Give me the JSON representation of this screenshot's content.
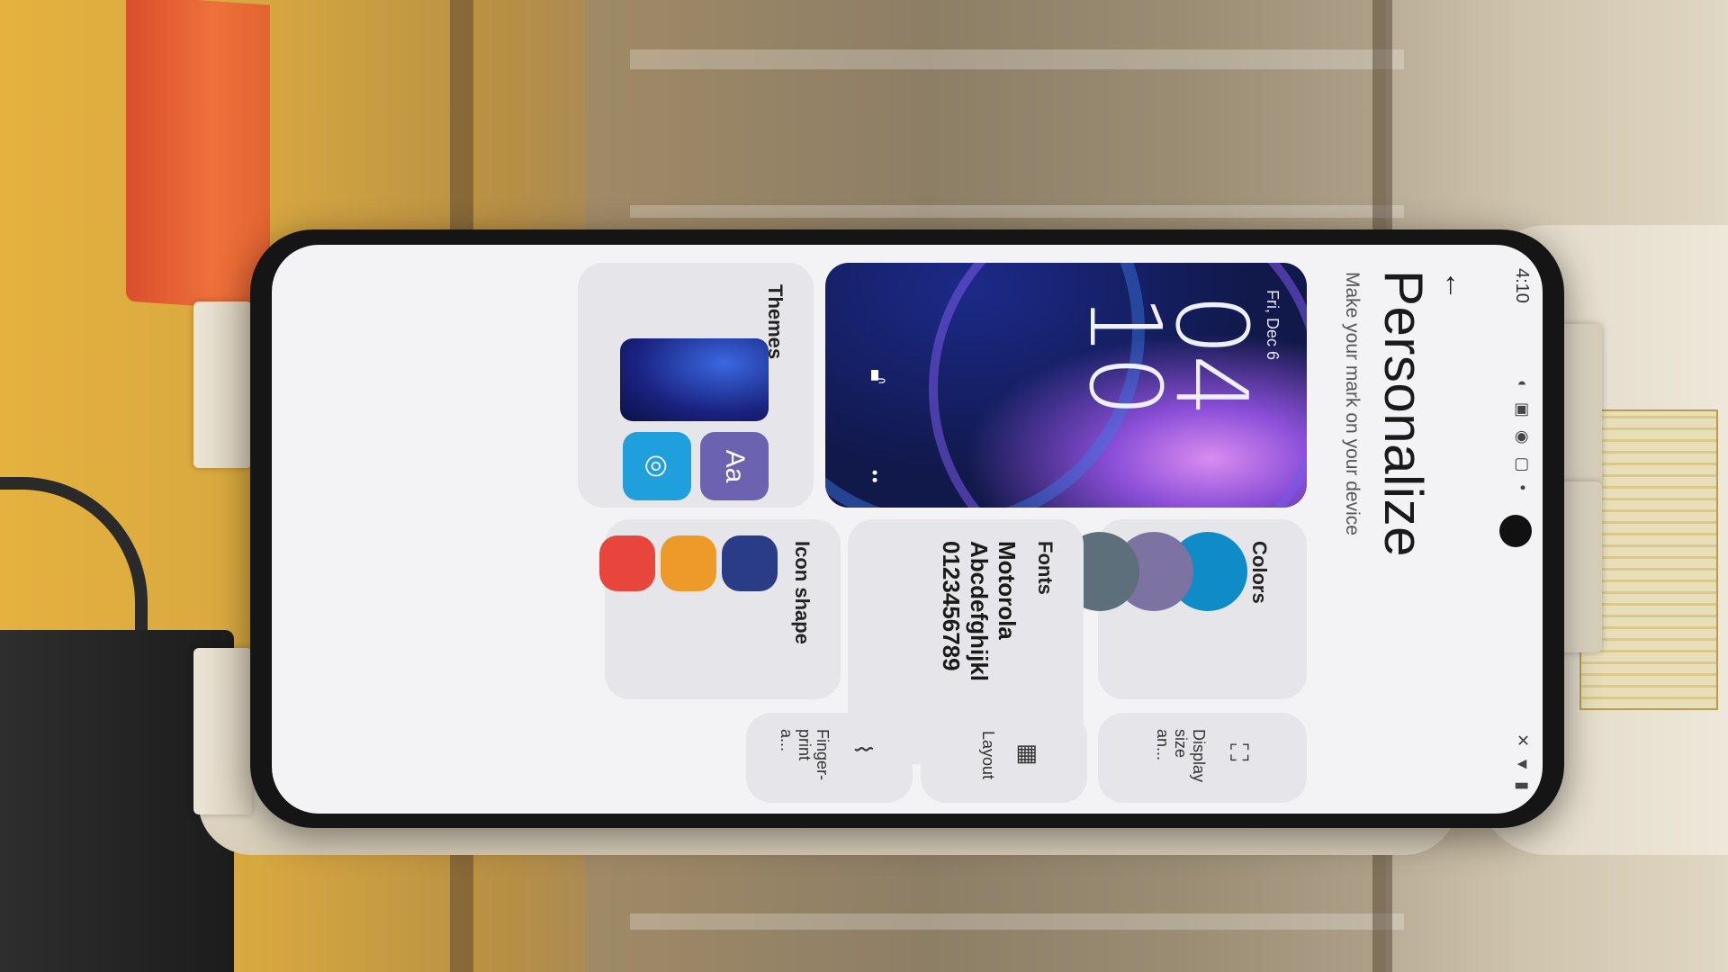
{
  "status_bar": {
    "time": "4:10"
  },
  "header": {
    "title": "Personalize",
    "subtitle": "Make your mark on your device"
  },
  "lock_preview": {
    "date": "Fri, Dec 6",
    "hour": "04",
    "minute": "10"
  },
  "tiles": {
    "themes": {
      "label": "Themes",
      "aa_label": "Aa"
    },
    "fonts": {
      "label": "Fonts",
      "sample_lines": [
        "Motorola",
        "Abcdefghijkl",
        "0123456789"
      ]
    },
    "colors": {
      "label": "Colors",
      "swatches": [
        "#0f8bc7",
        "#7c73a2",
        "#5e6f7c"
      ]
    },
    "icon_shape": {
      "label": "Icon shape"
    },
    "display_size": {
      "label": "Display size an..."
    },
    "layout": {
      "label": "Layout"
    },
    "fingerprint": {
      "label": "Finger-print a..."
    }
  },
  "icons": {
    "back": "arrow-left-icon",
    "display": "display-size-icon",
    "layout": "layout-grid-icon",
    "fingerprint": "fingerprint-icon",
    "lock": "lock-icon"
  }
}
